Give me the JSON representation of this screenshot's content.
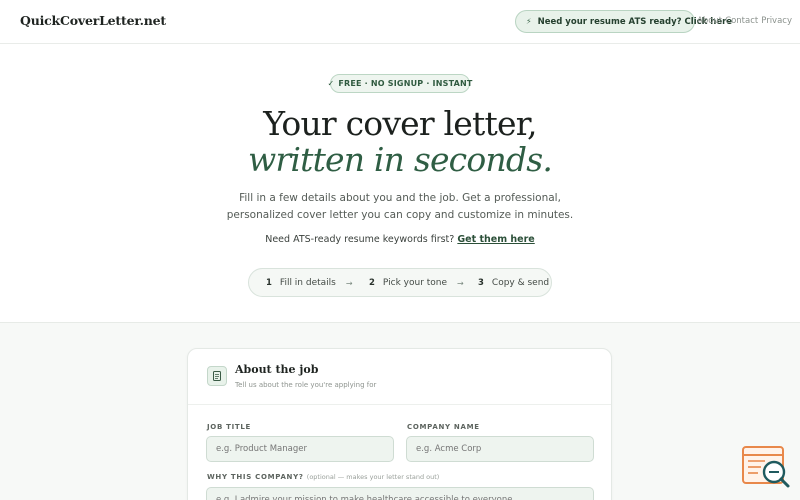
{
  "nav": {
    "logo": "QuickCoverLetter.net",
    "ats_cta": "Need your resume ATS ready? Click here",
    "links": [
      "About",
      "Contact",
      "Privacy"
    ]
  },
  "hero": {
    "badge": "FREE · NO SIGNUP · INSTANT",
    "title_line1": "Your cover letter,",
    "title_line2": "written in seconds.",
    "subtitle_line1": "Fill in a few details about you and the job. Get a professional,",
    "subtitle_line2": "personalized cover letter you can copy and customize in minutes.",
    "ats_prompt": "Need ATS-ready resume keywords first?",
    "ats_link": "Get them here"
  },
  "steps": [
    {
      "num": "1",
      "label": "Fill in details"
    },
    {
      "num": "2",
      "label": "Pick your tone"
    },
    {
      "num": "3",
      "label": "Copy & send"
    }
  ],
  "form": {
    "title": "About the job",
    "subtitle": "Tell us about the role you're applying for",
    "job_title_label": "JOB TITLE",
    "job_title_placeholder": "e.g. Product Manager",
    "company_label": "COMPANY NAME",
    "company_placeholder": "e.g. Acme Corp",
    "why_label": "WHY THIS COMPANY?",
    "why_optional": "(optional — makes your letter stand out)",
    "why_placeholder": "e.g. I admire your mission to make healthcare accessible to everyone..."
  },
  "colors": {
    "accent": "#2f5e44",
    "pill_bg": "#e8f2ea",
    "fab_orange": "#e8884a",
    "fab_teal": "#1f5a5e"
  },
  "icons": {
    "bolt": "bolt-icon",
    "check": "check-icon",
    "arrow": "arrow-right-icon",
    "document": "document-icon",
    "fab": "search-document-icon"
  }
}
